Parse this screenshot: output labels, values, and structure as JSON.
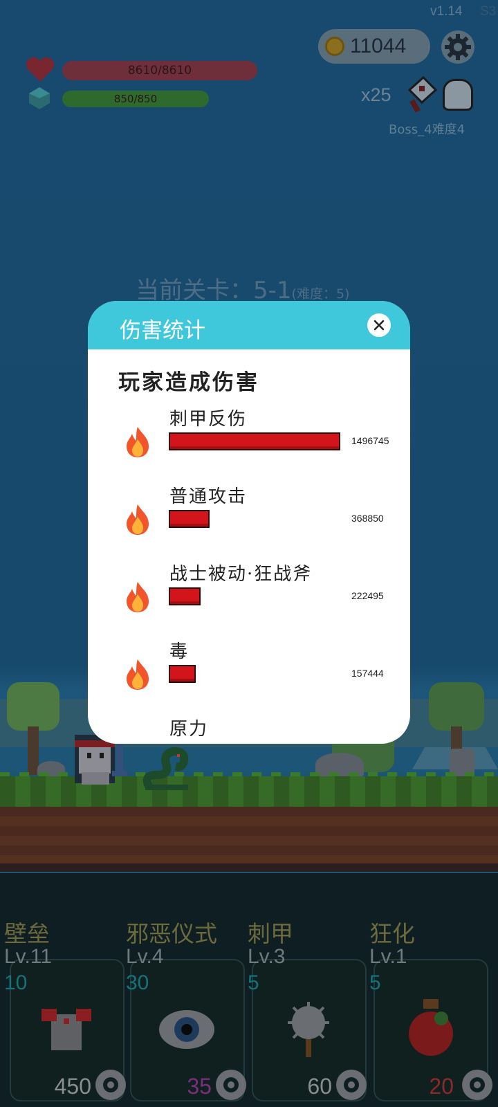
{
  "hud": {
    "version": "v1.14",
    "version_extra": "S3",
    "coins": "11044",
    "hp_text": "8610/8610",
    "mp_text": "850/850",
    "kill_count": "x25",
    "boss_label": "Boss_4难度4",
    "stage_label": "当前关卡：5-1",
    "stage_difficulty": "(难度：5)"
  },
  "modal": {
    "title": "伤害统计",
    "section_title": "玩家造成伤害",
    "rows": [
      {
        "name": "刺甲反伤",
        "value": "1496745",
        "amount": 1496745
      },
      {
        "name": "普通攻击",
        "value": "368850",
        "amount": 368850
      },
      {
        "name": "战士被动·狂战斧",
        "value": "222495",
        "amount": 222495
      },
      {
        "name": "毒",
        "value": "157444",
        "amount": 157444
      },
      {
        "name": "原力",
        "value": "",
        "amount": null
      }
    ],
    "bar_color": "#d3141b",
    "header_color": "#3fc8dc"
  },
  "skills": [
    {
      "name": "壁垒",
      "level": "Lv.11",
      "cost": "10",
      "price": "450",
      "price_color": "#8a8e90",
      "icon": "armor-icon"
    },
    {
      "name": "邪恶仪式",
      "level": "Lv.4",
      "cost": "30",
      "price": "35",
      "price_color": "#7a2e7e",
      "icon": "eye-icon"
    },
    {
      "name": "刺甲",
      "level": "Lv.3",
      "cost": "5",
      "price": "60",
      "price_color": "#8a8e90",
      "icon": "spiked-mace-icon"
    },
    {
      "name": "狂化",
      "level": "Lv.1",
      "cost": "5",
      "price": "20",
      "price_color": "#8a2a2a",
      "icon": "potion-icon"
    }
  ]
}
